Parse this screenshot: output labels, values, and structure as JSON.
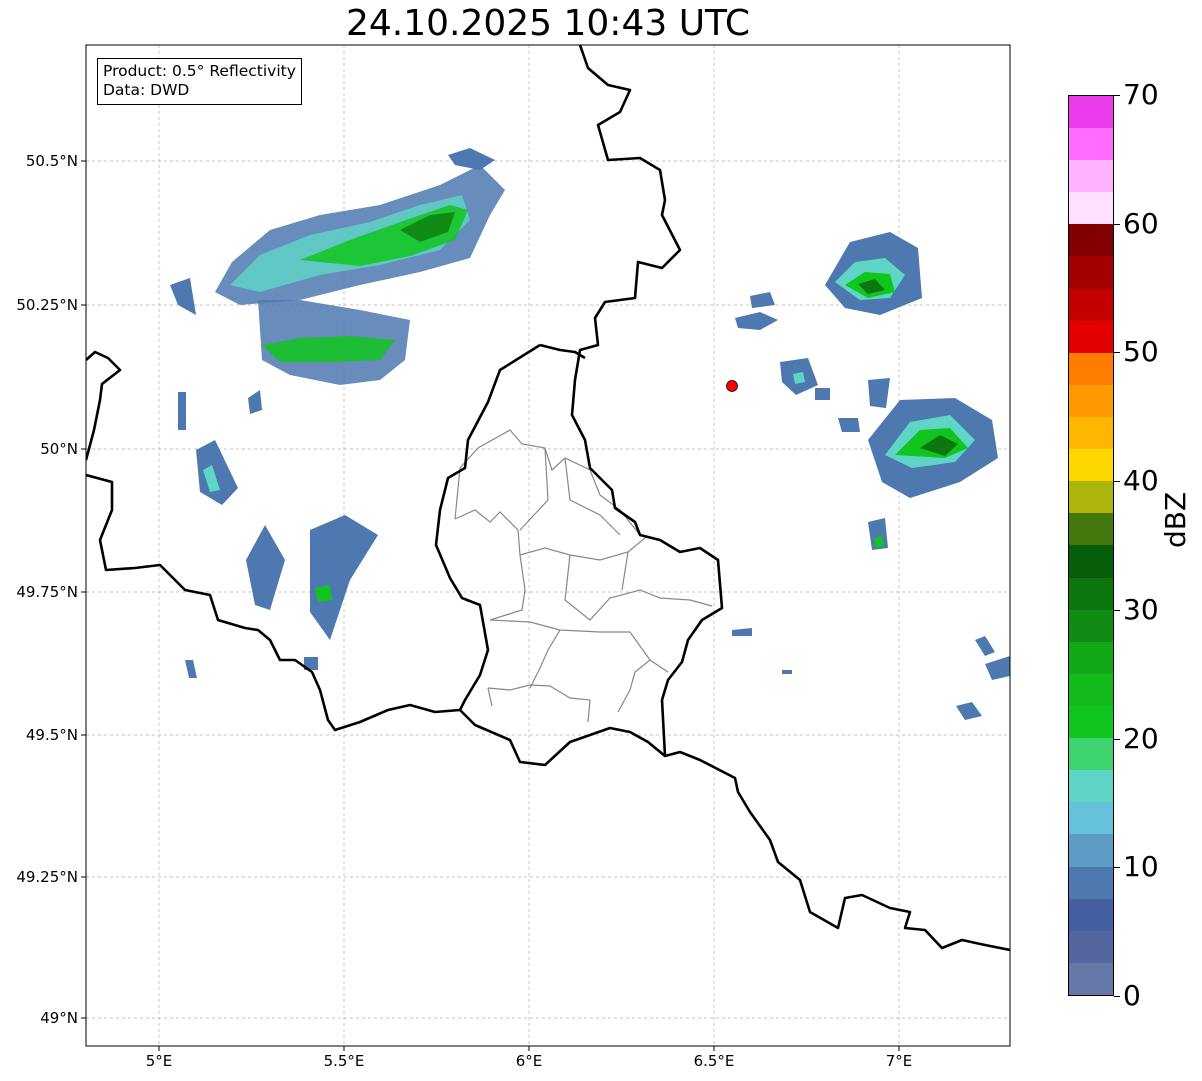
{
  "title": "24.10.2025 10:43 UTC",
  "info_box": {
    "product": "Product: 0.5° Reflectivity",
    "data": "Data: DWD"
  },
  "axes": {
    "lat_labels": [
      "50.5°N",
      "50.25°N",
      "50°N",
      "49.75°N",
      "49.5°N",
      "49.25°N",
      "49°N"
    ],
    "lon_labels": [
      "5°E",
      "5.5°E",
      "6°E",
      "6.5°E",
      "7°E"
    ]
  },
  "map": {
    "extent": {
      "lon_min": 4.8,
      "lon_max": 7.3,
      "lat_min": 48.95,
      "lat_max": 50.7
    },
    "grid": true,
    "radar_site": {
      "lon": 6.55,
      "lat": 50.11,
      "color": "#ff0000"
    },
    "border_color": "#000000",
    "district_color": "#888888"
  },
  "colorbar": {
    "unit": "dBZ",
    "min": 0,
    "max": 70,
    "step": 2.5,
    "tick_labels": [
      "0",
      "10",
      "20",
      "30",
      "40",
      "50",
      "60",
      "70"
    ],
    "colors": [
      "#6678a8",
      "#54659f",
      "#4460a2",
      "#4d78b0",
      "#5d9dc5",
      "#66c1db",
      "#5fd6c5",
      "#3dd36f",
      "#10c61e",
      "#13bb1a",
      "#12a817",
      "#108c14",
      "#0b770e",
      "#065d0a",
      "#45770f",
      "#adb50a",
      "#fed600",
      "#feb600",
      "#fe9900",
      "#fe7c00",
      "#e30000",
      "#c40000",
      "#a30000",
      "#820000",
      "#ffe0ff",
      "#ffb3ff",
      "#ff6bff",
      "#ea3aea"
    ]
  }
}
